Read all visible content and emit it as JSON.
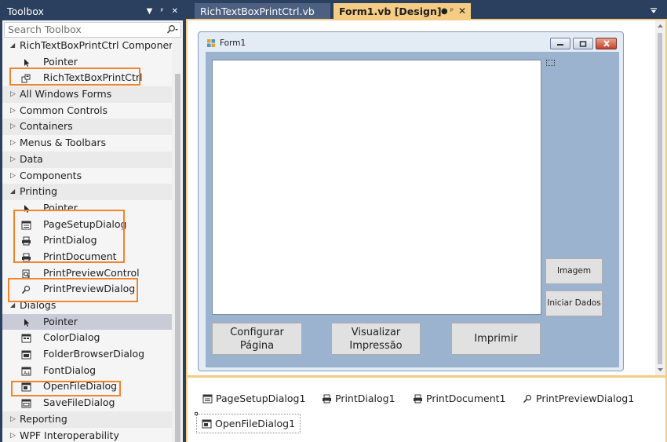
{
  "toolbox": {
    "title": "Toolbox",
    "header_buttons": [
      "▾",
      "ᵖ",
      "✕"
    ],
    "search_placeholder": "Search Toolbox",
    "rows": [
      {
        "kind": "cat",
        "open": true,
        "label": "RichTextBoxPrintCtrl Components"
      },
      {
        "kind": "item",
        "icon": "pointer",
        "label": "Pointer"
      },
      {
        "kind": "item",
        "icon": "control",
        "label": "RichTextBoxPrintCtrl"
      },
      {
        "kind": "cat",
        "open": false,
        "label": "All Windows Forms"
      },
      {
        "kind": "cat",
        "open": false,
        "label": "Common Controls"
      },
      {
        "kind": "cat",
        "open": false,
        "label": "Containers"
      },
      {
        "kind": "cat",
        "open": false,
        "label": "Menus & Toolbars"
      },
      {
        "kind": "cat",
        "open": false,
        "label": "Data"
      },
      {
        "kind": "cat",
        "open": false,
        "label": "Components"
      },
      {
        "kind": "cat",
        "open": true,
        "label": "Printing"
      },
      {
        "kind": "item",
        "icon": "pointer",
        "label": "Pointer"
      },
      {
        "kind": "item",
        "icon": "pagesetup",
        "label": "PageSetupDialog"
      },
      {
        "kind": "item",
        "icon": "printer",
        "label": "PrintDialog"
      },
      {
        "kind": "item",
        "icon": "printer",
        "label": "PrintDocument"
      },
      {
        "kind": "item",
        "icon": "preview",
        "label": "PrintPreviewControl"
      },
      {
        "kind": "item",
        "icon": "previewdlg",
        "label": "PrintPreviewDialog"
      },
      {
        "kind": "cat",
        "open": true,
        "label": "Dialogs"
      },
      {
        "kind": "item",
        "icon": "pointer",
        "label": "Pointer",
        "selected": true
      },
      {
        "kind": "item",
        "icon": "color",
        "label": "ColorDialog"
      },
      {
        "kind": "item",
        "icon": "folder",
        "label": "FolderBrowserDialog"
      },
      {
        "kind": "item",
        "icon": "font",
        "label": "FontDialog"
      },
      {
        "kind": "item",
        "icon": "openfile",
        "label": "OpenFileDialog"
      },
      {
        "kind": "item",
        "icon": "savefile",
        "label": "SaveFileDialog"
      },
      {
        "kind": "cat",
        "open": false,
        "label": "Reporting"
      },
      {
        "kind": "cat",
        "open": false,
        "label": "WPF Interoperability"
      }
    ]
  },
  "tabs": {
    "inactive": "RichTextBoxPrintCtrl.vb",
    "active": "Form1.vb [Design]"
  },
  "form": {
    "title": "Form1",
    "buttons": {
      "imagem": "Imagem",
      "iniciar": "Iniciar Dados",
      "configurar_1": "Configurar",
      "configurar_2": "Página",
      "visualizar_1": "Visualizar",
      "visualizar_2": "Impressão",
      "imprimir": "Imprimir"
    }
  },
  "tray": {
    "components": [
      {
        "icon": "pagesetup",
        "label": "PageSetupDialog1"
      },
      {
        "icon": "printer",
        "label": "PrintDialog1"
      },
      {
        "icon": "printer",
        "label": "PrintDocument1"
      },
      {
        "icon": "previewdlg",
        "label": "PrintPreviewDialog1"
      },
      {
        "icon": "openfile",
        "label": "OpenFileDialog1"
      }
    ]
  },
  "colors": {
    "chrome": "#2b3f5e",
    "active_tab": "#f5cc84",
    "highlight_box": "#f0852e",
    "form_client": "#9bb3cf"
  }
}
